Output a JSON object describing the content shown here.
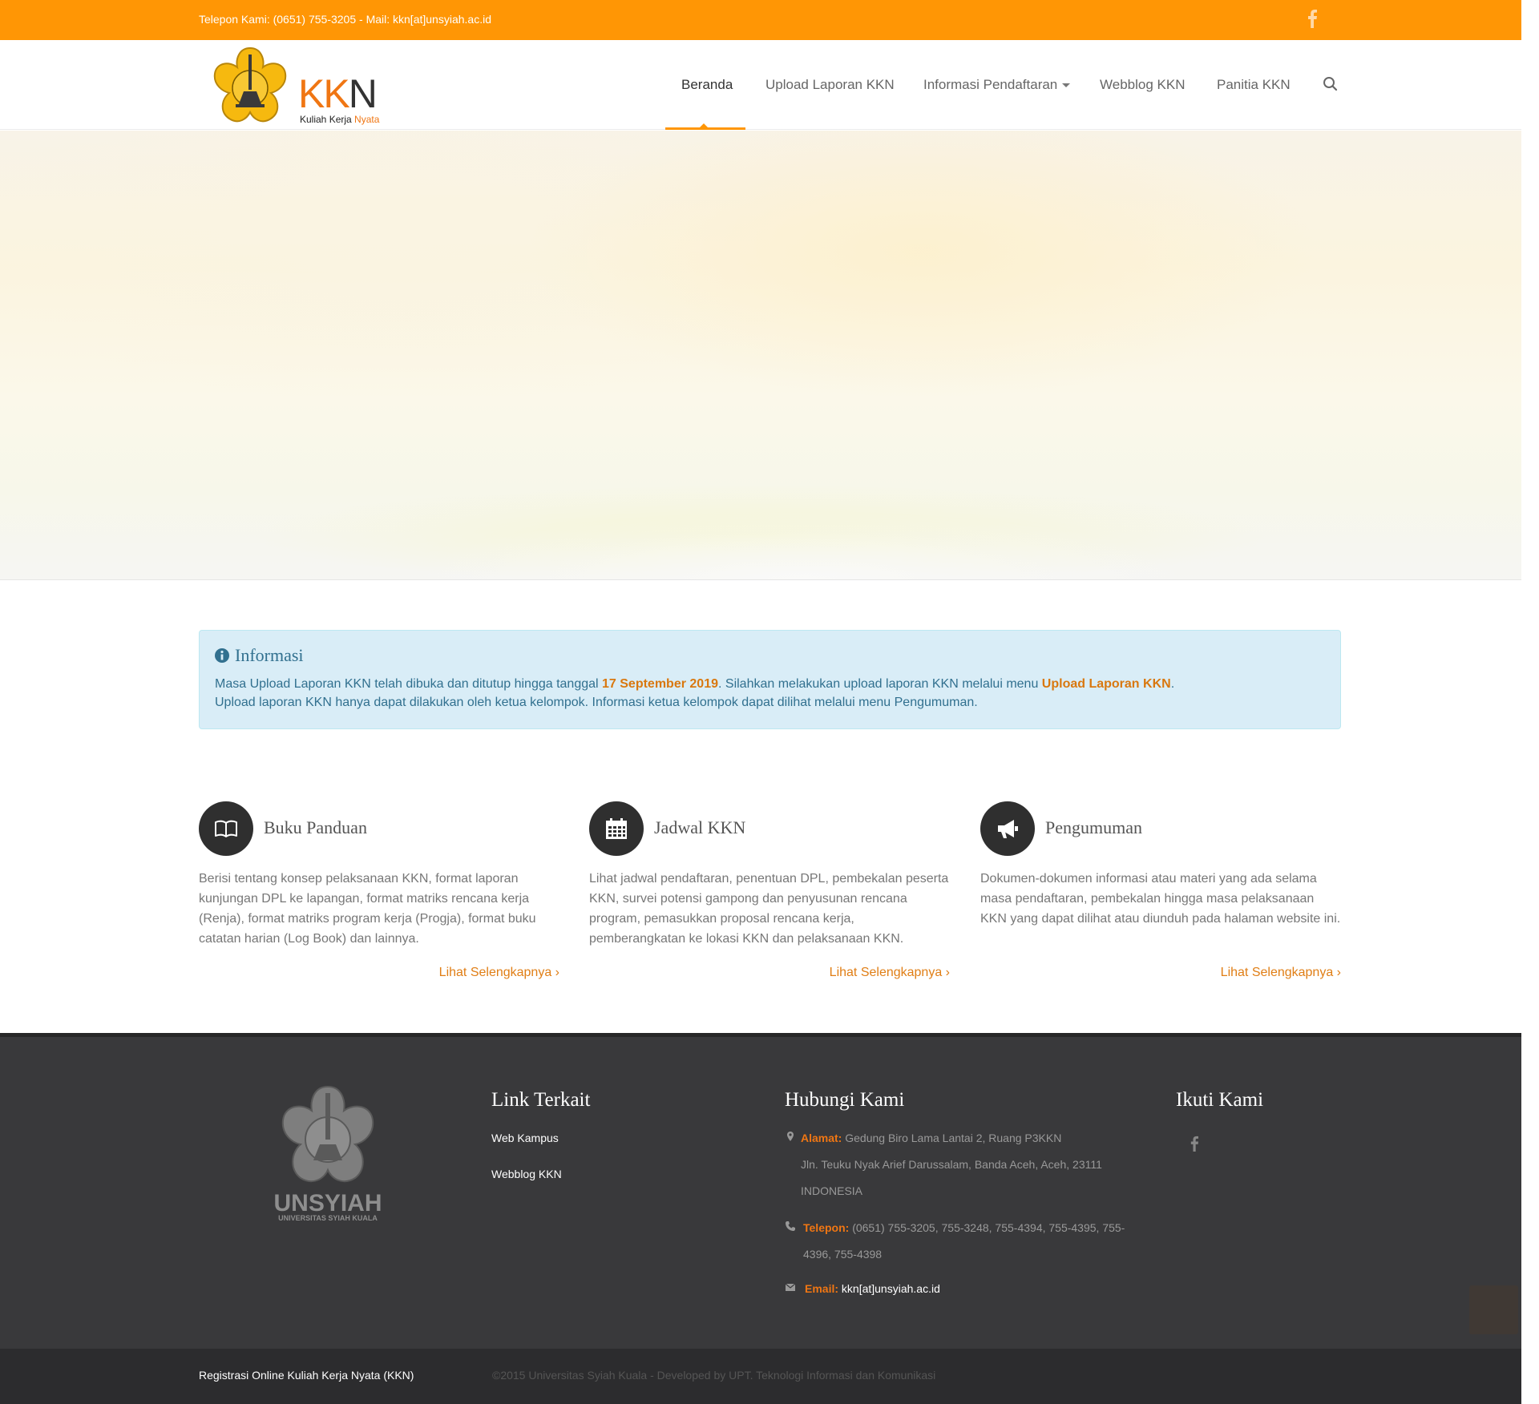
{
  "topbar": {
    "contact": "Telepon Kami: (0651) 755-3205 - Mail: kkn[at]unsyiah.ac.id",
    "facebook_icon": "facebook-icon"
  },
  "logo": {
    "kk": "KK",
    "n": "N",
    "sub_main": "Kuliah Kerja ",
    "sub_accent": "Nyata"
  },
  "nav": {
    "items": [
      {
        "label": "Beranda",
        "active": true
      },
      {
        "label": "Upload Laporan KKN"
      },
      {
        "label": "Informasi Pendaftaran",
        "dropdown": true
      },
      {
        "label": "Webblog KKN"
      },
      {
        "label": "Panitia KKN"
      }
    ],
    "search_icon": "search-icon"
  },
  "info": {
    "title": "Informasi",
    "line1_a": "Masa Upload Laporan KKN telah dibuka dan ditutup hingga tanggal ",
    "line1_date": "17 September 2019",
    "line1_b": ". Silahkan melakukan upload laporan KKN melalui menu ",
    "line1_link": "Upload Laporan KKN",
    "line1_c": ".",
    "line2": "Upload laporan KKN hanya dapat dilakukan oleh ketua kelompok. Informasi ketua kelompok dapat dilihat melalui menu Pengumuman."
  },
  "features": [
    {
      "title": "Buku Panduan",
      "icon": "book-icon",
      "desc": "Berisi tentang konsep pelaksanaan KKN, format laporan kunjungan DPL ke lapangan, format matriks rencana kerja (Renja), format matriks program kerja (Progja), format buku catatan harian (Log Book) dan lainnya.",
      "more": "Lihat Selengkapnya ›"
    },
    {
      "title": "Jadwal KKN",
      "icon": "calendar-icon",
      "desc": "Lihat jadwal pendaftaran, penentuan DPL, pembekalan peserta KKN, survei potensi gampong dan penyusunan rencana program, pemasukkan proposal rencana kerja, pemberangkatan ke lokasi KKN dan pelaksanaan KKN.",
      "more": "Lihat Selengkapnya ›"
    },
    {
      "title": "Pengumuman",
      "icon": "megaphone-icon",
      "desc": "Dokumen-dokumen informasi atau materi yang ada selama masa pendaftaran, pembekalan hingga masa pelaksanaan KKN yang dapat dilihat atau diunduh pada halaman website ini.",
      "more": "Lihat Selengkapnya ›"
    }
  ],
  "footer": {
    "logo_text": "UNSYIAH",
    "logo_sub": "UNIVERSITAS SYIAH KUALA",
    "links_title": "Link Terkait",
    "links": [
      "Web Kampus",
      "Webblog KKN"
    ],
    "contact_title": "Hubungi Kami",
    "address_label": "Alamat:",
    "address_1": "Gedung Biro Lama Lantai 2, Ruang P3KKN",
    "address_2": "Jln. Teuku Nyak Arief Darussalam, Banda Aceh, Aceh, 23111",
    "address_3": "INDONESIA",
    "phone_label": "Telepon:",
    "phone_1": "(0651) 755-3205, 755-3248, 755-4394, 755-4395, 755-",
    "phone_2": "4396, 755-4398",
    "email_label": "Email:",
    "email": "kkn[at]unsyiah.ac.id",
    "follow_title": "Ikuti Kami"
  },
  "copyright": {
    "left": "Registrasi Online Kuliah Kerja Nyata (KKN)",
    "right": "©2015 Universitas Syiah Kuala - Developed by UPT. Teknologi Informasi dan Komunikasi"
  },
  "colors": {
    "accent": "#ff9605",
    "link_orange": "#e07e15",
    "footer_bg": "#39393b",
    "info_bg": "#d9edf7"
  }
}
